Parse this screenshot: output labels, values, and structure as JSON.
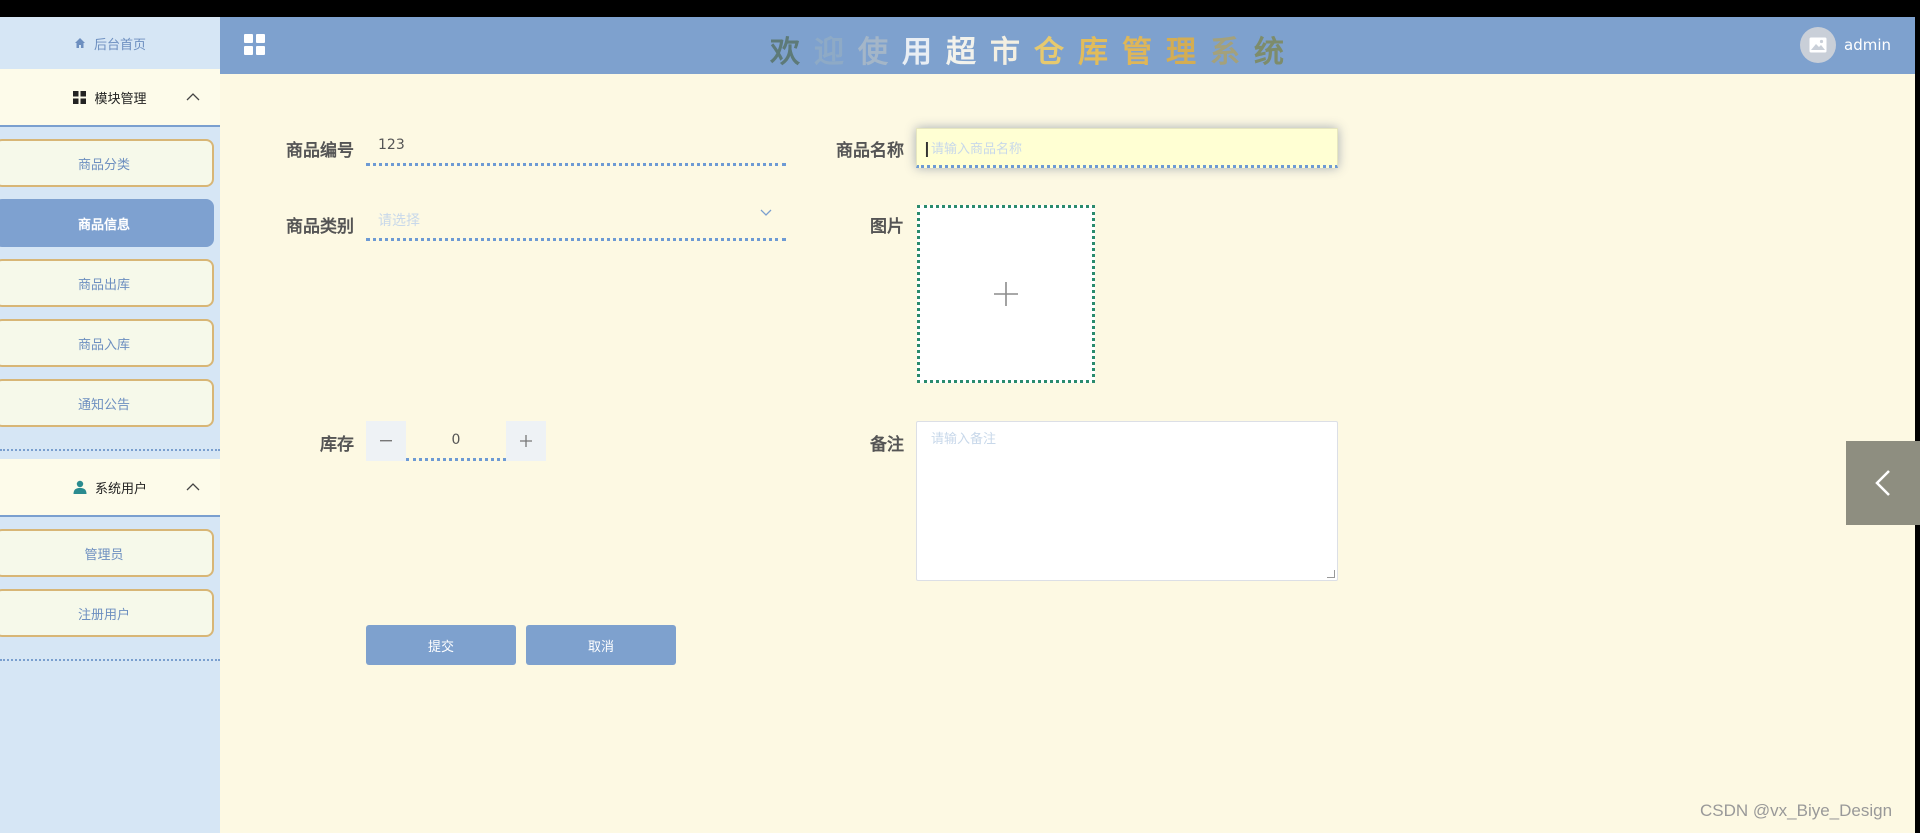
{
  "sidebar": {
    "home_label": "后台首页",
    "groups": [
      {
        "title": "模块管理",
        "items": [
          {
            "label": "商品分类",
            "active": false
          },
          {
            "label": "商品信息",
            "active": true
          },
          {
            "label": "商品出库",
            "active": false
          },
          {
            "label": "商品入库",
            "active": false
          },
          {
            "label": "通知公告",
            "active": false
          }
        ]
      },
      {
        "title": "系统用户",
        "items": [
          {
            "label": "管理员",
            "active": false
          },
          {
            "label": "注册用户",
            "active": false
          }
        ]
      }
    ]
  },
  "header": {
    "title_chars": [
      {
        "ch": "欢",
        "color": "#5d7a78"
      },
      {
        "ch": "迎",
        "color": "#8eaac6"
      },
      {
        "ch": "使",
        "color": "#a4b6c8"
      },
      {
        "ch": "用",
        "color": "#e9eef4"
      },
      {
        "ch": "超",
        "color": "#f2f2ec"
      },
      {
        "ch": "市",
        "color": "#f3efe2"
      },
      {
        "ch": "仓",
        "color": "#e7c96e"
      },
      {
        "ch": "库",
        "color": "#e2bc5a"
      },
      {
        "ch": "管",
        "color": "#dfb658"
      },
      {
        "ch": "理",
        "color": "#d4ad53"
      },
      {
        "ch": "系",
        "color": "#a4a17b"
      },
      {
        "ch": "统",
        "color": "#7d8c6b"
      }
    ],
    "user": "admin"
  },
  "form": {
    "code_label": "商品编号",
    "code_value": "123",
    "name_label": "商品名称",
    "name_placeholder": "请输入商品名称",
    "category_label": "商品类别",
    "category_placeholder": "请选择",
    "image_label": "图片",
    "stock_label": "库存",
    "stock_value": "0",
    "remark_label": "备注",
    "remark_placeholder": "请输入备注",
    "submit_label": "提交",
    "cancel_label": "取消"
  },
  "watermark": "CSDN @vx_Biye_Design"
}
